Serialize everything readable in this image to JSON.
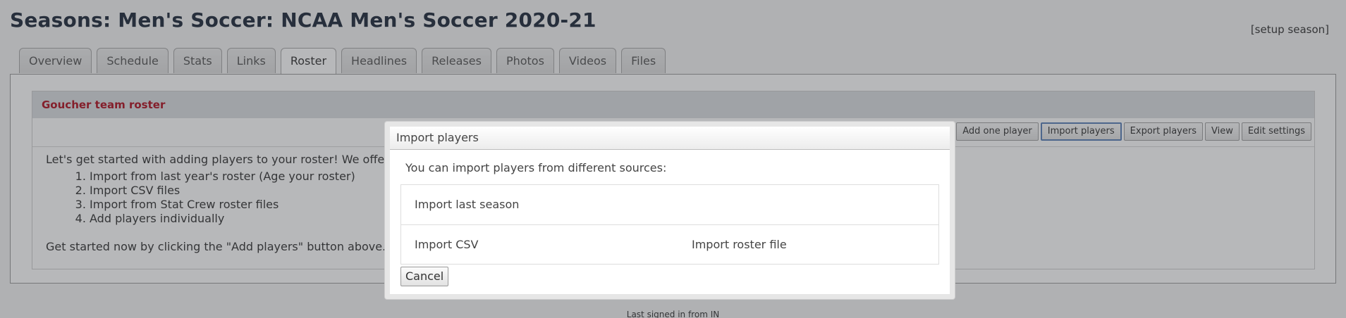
{
  "header": {
    "title": "Seasons: Men's Soccer: NCAA Men's Soccer 2020-21",
    "setup_link": "[setup season]"
  },
  "tabs": [
    {
      "label": "Overview",
      "active": false
    },
    {
      "label": "Schedule",
      "active": false
    },
    {
      "label": "Stats",
      "active": false
    },
    {
      "label": "Links",
      "active": false
    },
    {
      "label": "Roster",
      "active": true
    },
    {
      "label": "Headlines",
      "active": false
    },
    {
      "label": "Releases",
      "active": false
    },
    {
      "label": "Photos",
      "active": false
    },
    {
      "label": "Videos",
      "active": false
    },
    {
      "label": "Files",
      "active": false
    }
  ],
  "roster": {
    "header": "Goucher team roster",
    "actions": {
      "add_one": "Add one player",
      "import": "Import players",
      "export": "Export players",
      "view": "View",
      "edit_settings": "Edit settings"
    },
    "intro": "Let's get started with adding players to your roster! We offer sev",
    "steps": [
      "Import from last year's roster (Age your roster)",
      "Import CSV files",
      "Import from Stat Crew roster files",
      "Add players individually"
    ],
    "get_started": "Get started now by clicking the \"Add players\" button above."
  },
  "footer": {
    "text": "Last signed in from IN"
  },
  "dialog": {
    "title": "Import players",
    "intro": "You can import players from different sources:",
    "options": {
      "last_season": "Import last season",
      "csv": "Import CSV",
      "roster_file": "Import roster file"
    },
    "cancel": "Cancel"
  }
}
